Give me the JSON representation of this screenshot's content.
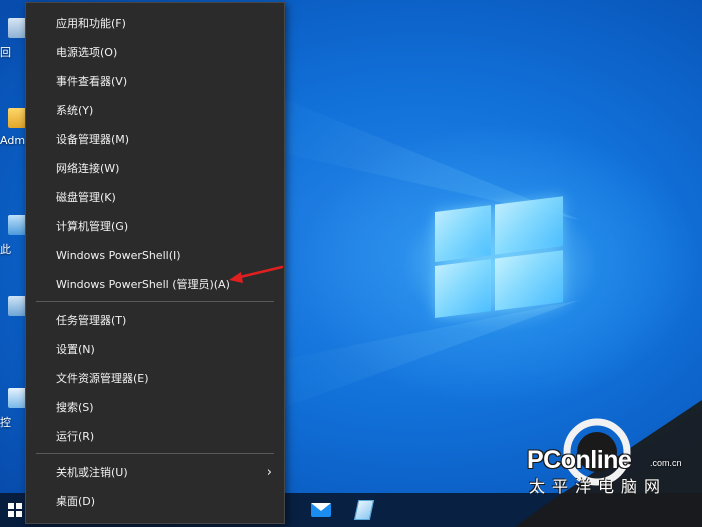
{
  "desktop": {
    "icons": [
      {
        "name": "recycle-bin",
        "label": "回"
      },
      {
        "name": "admin-folder",
        "label": "Adm"
      },
      {
        "name": "this-pc",
        "label": "此"
      },
      {
        "name": "network",
        "label": ""
      },
      {
        "name": "control-panel",
        "label": "控"
      }
    ],
    "accent_color": "#0a5fc4"
  },
  "context_menu": {
    "groups": [
      [
        "应用和功能(F)",
        "电源选项(O)",
        "事件查看器(V)",
        "系统(Y)",
        "设备管理器(M)",
        "网络连接(W)",
        "磁盘管理(K)",
        "计算机管理(G)",
        "Windows PowerShell(I)",
        "Windows PowerShell (管理员)(A)"
      ],
      [
        "任务管理器(T)",
        "设置(N)",
        "文件资源管理器(E)",
        "搜索(S)",
        "运行(R)"
      ],
      [
        "关机或注销(U)",
        "桌面(D)"
      ]
    ],
    "submenu_arrow": "›",
    "background": "#2b2b2b"
  },
  "annotation": {
    "color": "#e02020",
    "points_to": "Windows PowerShell (管理员)(A)"
  },
  "taskbar": {
    "items": [
      "start-icon",
      "mail-icon",
      "notes-icon"
    ]
  },
  "watermark": {
    "brand": "PConline",
    "domain": ".com.cn",
    "chinese": "太平洋电脑网"
  }
}
